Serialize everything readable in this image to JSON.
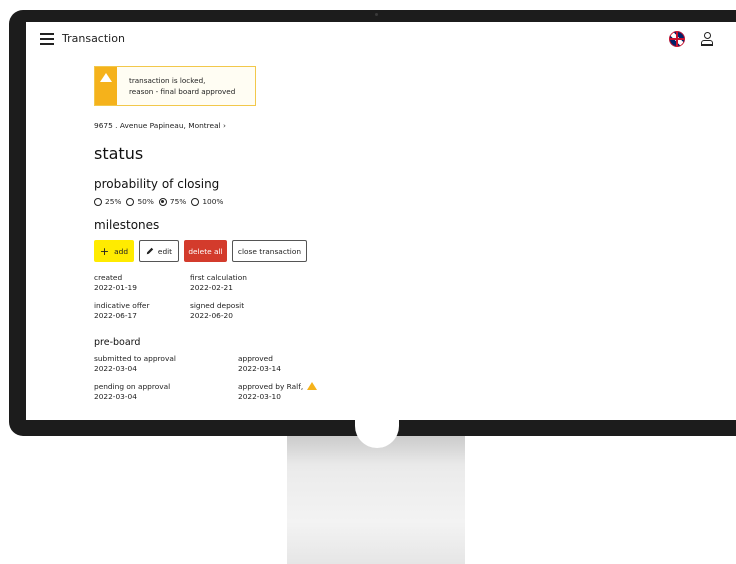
{
  "app": {
    "title": "Transaction"
  },
  "alert": {
    "line1": "transaction is locked,",
    "line2": "reason - final board approved"
  },
  "breadcrumb": {
    "address": "9675 . Avenue Papineau, Montreal ›"
  },
  "status": {
    "heading": "status"
  },
  "probability": {
    "heading": "probability of closing",
    "options": [
      "25%",
      "50%",
      "75%",
      "100%"
    ],
    "selected": "75%"
  },
  "milestones": {
    "heading": "milestones",
    "buttons": {
      "add": "add",
      "edit": "edit",
      "delete_all": "delete all",
      "close_transaction": "close transaction"
    },
    "items": [
      {
        "label": "created",
        "date": "2022-01-19"
      },
      {
        "label": "first calculation",
        "date": "2022-02-21"
      },
      {
        "label": "indicative offer",
        "date": "2022-06-17"
      },
      {
        "label": "signed deposit",
        "date": "2022-06-20"
      }
    ]
  },
  "preboard": {
    "heading": "pre-board",
    "items": [
      {
        "label": "submitted to approval",
        "date": "2022-03-04"
      },
      {
        "label": "approved",
        "date": "2022-03-14"
      },
      {
        "label": "pending on approval",
        "date": "2022-03-04"
      },
      {
        "label": "approved by Ralf,",
        "date": "2022-03-10"
      }
    ]
  },
  "colors": {
    "accent_yellow": "#ffeb00",
    "danger_red": "#d33b2c",
    "warning_amber": "#f5b21b"
  }
}
